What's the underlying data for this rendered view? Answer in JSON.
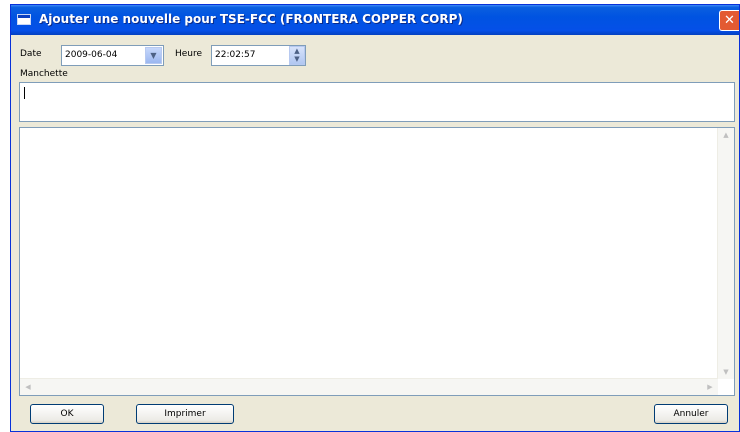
{
  "window": {
    "title": "Ajouter une nouvelle pour TSE-FCC (FRONTERA COPPER CORP)",
    "close_icon": "close-icon"
  },
  "form": {
    "date_label": "Date",
    "date_value": "2009-06-04",
    "time_label": "Heure",
    "time_value": "22:02:57",
    "headline_label": "Manchette",
    "headline_value": "",
    "body_value": ""
  },
  "buttons": {
    "ok": "OK",
    "print": "Imprimer",
    "cancel": "Annuler"
  },
  "colors": {
    "titlebar": "#0053e1",
    "window_bg": "#ece9d8",
    "close": "#e35a32"
  }
}
